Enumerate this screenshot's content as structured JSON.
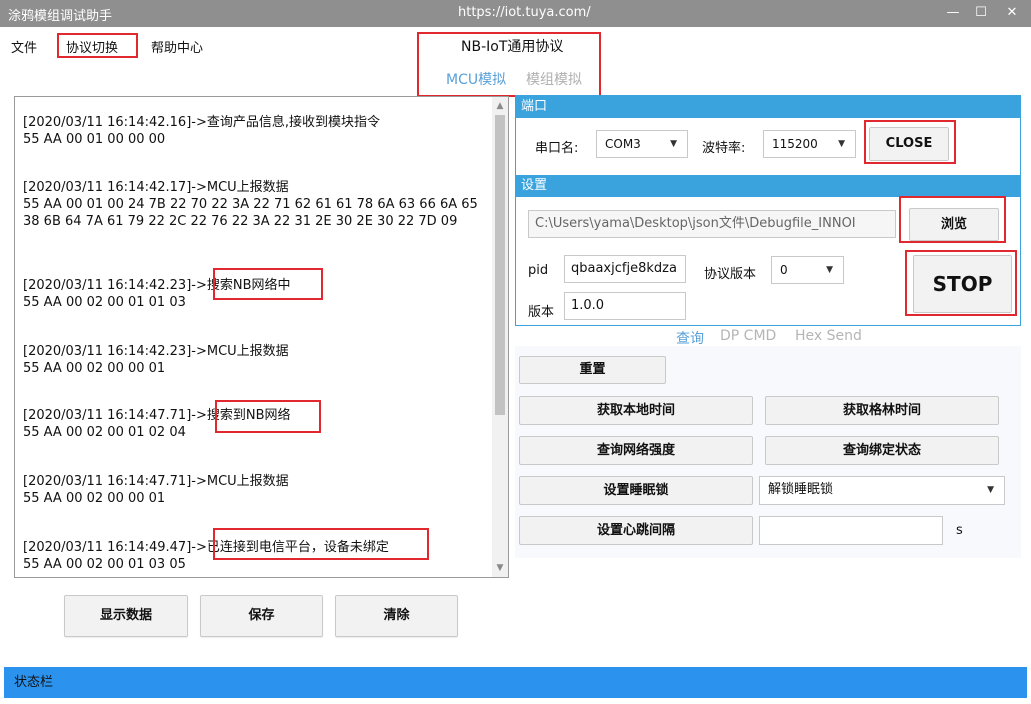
{
  "window": {
    "title": "涂鸦模组调试助手",
    "url": "https://iot.tuya.com/",
    "minimize": "—",
    "maximize": "☐",
    "close": "✕"
  },
  "menu": {
    "file": "文件",
    "protocol_switch": "协议切换",
    "help": "帮助中心"
  },
  "protocol": {
    "title": "NB-IoT通用协议",
    "tab_mcu": "MCU模拟",
    "tab_module": "模组模拟"
  },
  "log": [
    {
      "header": "[2020/03/11 16:14:42.16]->查询产品信息,接收到模块指令",
      "data": "55 AA 00 01 00 00 00"
    },
    {
      "header": "[2020/03/11 16:14:42.17]->MCU上报数据",
      "data": "55 AA 00 01 00 24 7B 22 70 22 3A 22 71 62 61 61 78 6A 63 66 6A 65 38 6B 64 7A 61 79 22 2C 22 76 22 3A 22 31 2E 30 2E 30 22 7D 09"
    },
    {
      "header": "[2020/03/11 16:14:42.23]->搜索NB网络中",
      "data": "55 AA 00 02 00 01 01 03"
    },
    {
      "header": "[2020/03/11 16:14:42.23]->MCU上报数据",
      "data": "55 AA 00 02 00 00 01"
    },
    {
      "header": "[2020/03/11 16:14:47.71]->搜索到NB网络",
      "data": "55 AA 00 02 00 01 02 04"
    },
    {
      "header": "[2020/03/11 16:14:47.71]->MCU上报数据",
      "data": "55 AA 00 02 00 00 01"
    },
    {
      "header": "[2020/03/11 16:14:49.47]->已连接到电信平台，设备未绑定",
      "data": "55 AA 00 02 00 01 03 05"
    }
  ],
  "log_buttons": {
    "show": "显示数据",
    "save": "保存",
    "clear": "清除"
  },
  "port": {
    "section": "端口",
    "serial_label": "串口名:",
    "serial_value": "COM3",
    "baud_label": "波特率:",
    "baud_value": "115200",
    "close_button": "CLOSE"
  },
  "settings": {
    "section": "设置",
    "path_value": "C:\\Users\\yama\\Desktop\\json文件\\Debugfile_INNOI",
    "browse_button": "浏览",
    "pid_label": "pid",
    "pid_value": "qbaaxjcfje8kdza",
    "proto_version_label": "协议版本",
    "proto_version_value": "0",
    "version_label": "版本",
    "version_value": "1.0.0",
    "stop_button": "STOP"
  },
  "cmd_tabs": {
    "query": "查询",
    "dp_cmd": "DP CMD",
    "hex_send": "Hex Send"
  },
  "commands": {
    "reset": "重置",
    "get_local_time": "获取本地时间",
    "get_gmt_time": "获取格林时间",
    "query_signal": "查询网络强度",
    "query_bind": "查询绑定状态",
    "set_sleep_lock": "设置睡眠锁",
    "sleep_lock_option": "解锁睡眠锁",
    "set_heartbeat": "设置心跳间隔",
    "heartbeat_value": "",
    "heartbeat_unit": "s"
  },
  "status_bar": "状态栏",
  "colors": {
    "accent": "#3aa3de",
    "status": "#2b93ee",
    "highlight": "#e0282e",
    "tab_active": "#5aa0d8"
  }
}
